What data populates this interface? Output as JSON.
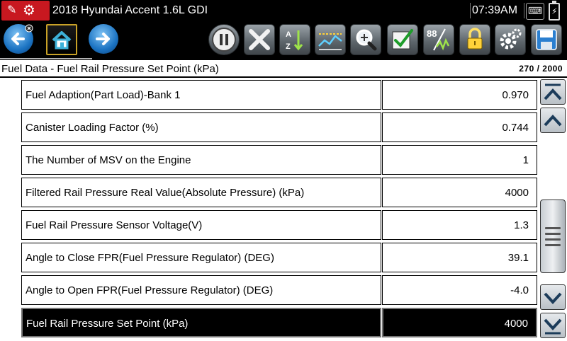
{
  "titlebar": {
    "vehicle": "2018 Hyundai Accent 1.6L GDI",
    "time": "07:39AM"
  },
  "toolbar": {
    "buttons": [
      "back-icon",
      "home-icon",
      "forward-icon",
      "pause-icon",
      "clear-icon",
      "sort-icon",
      "graph-icon",
      "zoom-icon",
      "check-icon",
      "units-icon",
      "lock-icon",
      "settings-icon",
      "save-icon"
    ],
    "units_label": "88"
  },
  "header": {
    "title": "Fuel Data - Fuel Rail Pressure Set Point (kPa)",
    "count": "270 / 2000"
  },
  "rows": [
    {
      "name": "Fuel Adaption(Part Load)-Bank 1",
      "value": "0.970"
    },
    {
      "name": "Canister Loading Factor (%)",
      "value": "0.744"
    },
    {
      "name": "The Number of MSV on the Engine",
      "value": "1"
    },
    {
      "name": "Filtered Rail Pressure Real Value(Absolute Pressure) (kPa)",
      "value": "4000"
    },
    {
      "name": "Fuel Rail Pressure Sensor Voltage(V)",
      "value": "1.3"
    },
    {
      "name": "Angle to Close FPR(Fuel Pressure Regulator) (DEG)",
      "value": "39.1"
    },
    {
      "name": "Angle to Open FPR(Fuel Pressure Regulator) (DEG)",
      "value": "-4.0"
    },
    {
      "name": "Fuel Rail Pressure Set Point (kPa)",
      "value": "4000",
      "selected": true
    }
  ],
  "colors": {
    "bar_bg": "#000000",
    "accent_red": "#c81820",
    "nav_blue": "#1b73c2",
    "home_border": "#c9a227"
  }
}
